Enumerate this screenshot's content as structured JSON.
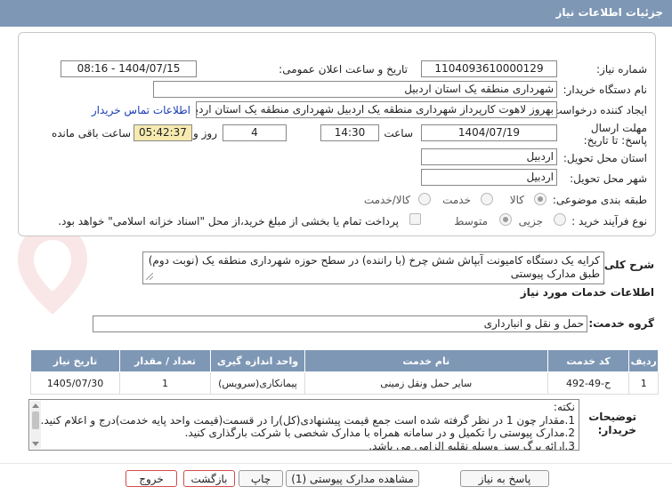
{
  "window": {
    "title": "جزئیات اطلاعات نیاز"
  },
  "fields": {
    "need_number_label": "شماره نیاز:",
    "need_number": "1104093610000129",
    "announce_label": "تاریخ و ساعت اعلان عمومی:",
    "announce_value": "1404/07/15 - 08:16",
    "buyer_label": "نام دستگاه خریدار:",
    "buyer_value": "شهرداری منطقه یک استان اردبیل",
    "creator_label": "ایجاد کننده درخواست:",
    "creator_value": "بهروز لاهوت کارپرداز شهرداری منطقه یک اردبیل شهرداری منطقه یک استان اردبیل",
    "contact_link": "اطلاعات تماس خریدار",
    "deadline_label": "مهلت ارسال پاسخ: تا تاریخ:",
    "deadline_date": "1404/07/19",
    "time_label": "ساعت",
    "deadline_time": "14:30",
    "days_value": "4",
    "days_label": "روز و",
    "remaining_time": "05:42:37",
    "remaining_label": "ساعت باقی مانده",
    "province_label": "استان محل تحویل:",
    "province_value": "اردبیل",
    "city_label": "شهر محل تحویل:",
    "city_value": "اردبیل",
    "category_label": "طبقه بندی موضوعی:",
    "category_options": [
      "کالا",
      "خدمت",
      "کالا/خدمت"
    ],
    "process_label": "نوع فرآیند خرید :",
    "process_options": [
      "جزیی",
      "متوسط"
    ],
    "payment_text": "پرداخت تمام یا بخشی از مبلغ خرید،از محل \"اسناد خزانه اسلامی\" خواهد بود."
  },
  "summary": {
    "label": "شرح کلی نیاز:",
    "text": "کرایه یک دستگاه کامیونت آبپاش شش چرخ (با راننده) در سطح حوزه شهرداری منطقه یک (نوبت دوم) طبق مدارک پیوستی"
  },
  "services": {
    "title": "اطلاعات خدمات مورد نیاز",
    "group_label": "گروه خدمت:",
    "group_value": "حمل و نقل و انبارداری",
    "headers": [
      "ردیف",
      "کد خدمت",
      "نام خدمت",
      "واحد اندازه گیری",
      "تعداد / مقدار",
      "تاریخ نیاز"
    ],
    "rows": [
      [
        "1",
        "ح-49-492",
        "سایر حمل ونقل زمینی",
        "پیمانکاری(سرویس)",
        "1",
        "1405/07/30"
      ]
    ]
  },
  "buyer_notes": {
    "label_line1": "توضیحات",
    "label_line2": "خریدار:",
    "lines": [
      "نکته:",
      "1.مقدار چون 1 در نظر گرفته شده است جمع قیمت پیشنهادی(کل)را در قسمت(قیمت واحد پایه خدمت)درج و اعلام کنید.",
      "2.مدارک پیوستی را تکمیل و در سامانه همراه با مدارک شخصی با شرکت بارگذاری کنید.",
      "3.ارائه برگ سبز وسیله نقلیه الزامی می باشد."
    ]
  },
  "buttons": {
    "reply": "پاسخ به نیاز",
    "attachments": "مشاهده مدارک پیوستی (1)",
    "print": "چاپ",
    "back": "بازگشت",
    "exit": "خروج"
  },
  "colors": {
    "header": "#7e97b5",
    "link": "#1a3cb5",
    "timer_bg": "#f6eab0",
    "danger_border": "#d24b4b"
  }
}
